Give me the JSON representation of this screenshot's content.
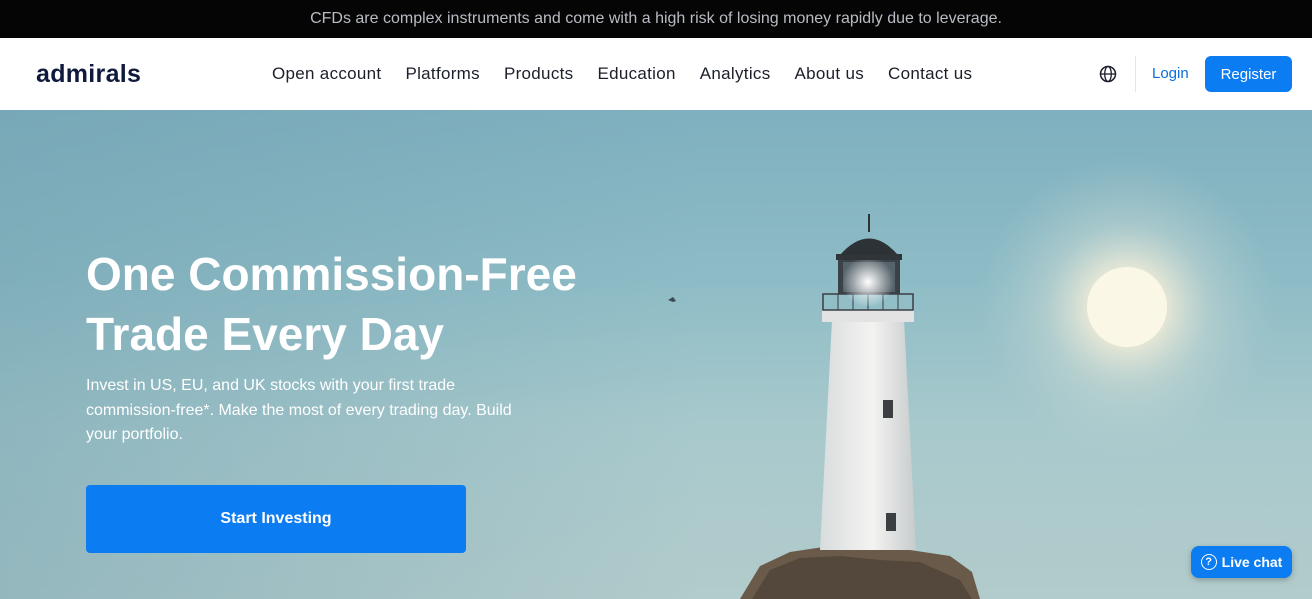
{
  "risk_banner": {
    "text": "CFDs are complex instruments and come with a high risk of losing money rapidly due to leverage."
  },
  "header": {
    "logo": "admirals",
    "nav": [
      "Open account",
      "Platforms",
      "Products",
      "Education",
      "Analytics",
      "About us",
      "Contact us"
    ],
    "language_icon": "globe-icon",
    "login_label": "Login",
    "register_label": "Register"
  },
  "hero": {
    "title": "One Commission-Free Trade Every Day",
    "subtitle": "Invest in US, EU, and UK stocks with your first trade commission-free*. Make the most of every trading day. Build your portfolio.",
    "cta_label": "Start Investing",
    "image": "lighthouse-photo"
  },
  "live_chat": {
    "label": "Live chat",
    "icon": "question-icon"
  },
  "colors": {
    "brand_blue": "#0b7cf2",
    "logo_navy": "#101a3d",
    "banner_bg": "#050505"
  }
}
